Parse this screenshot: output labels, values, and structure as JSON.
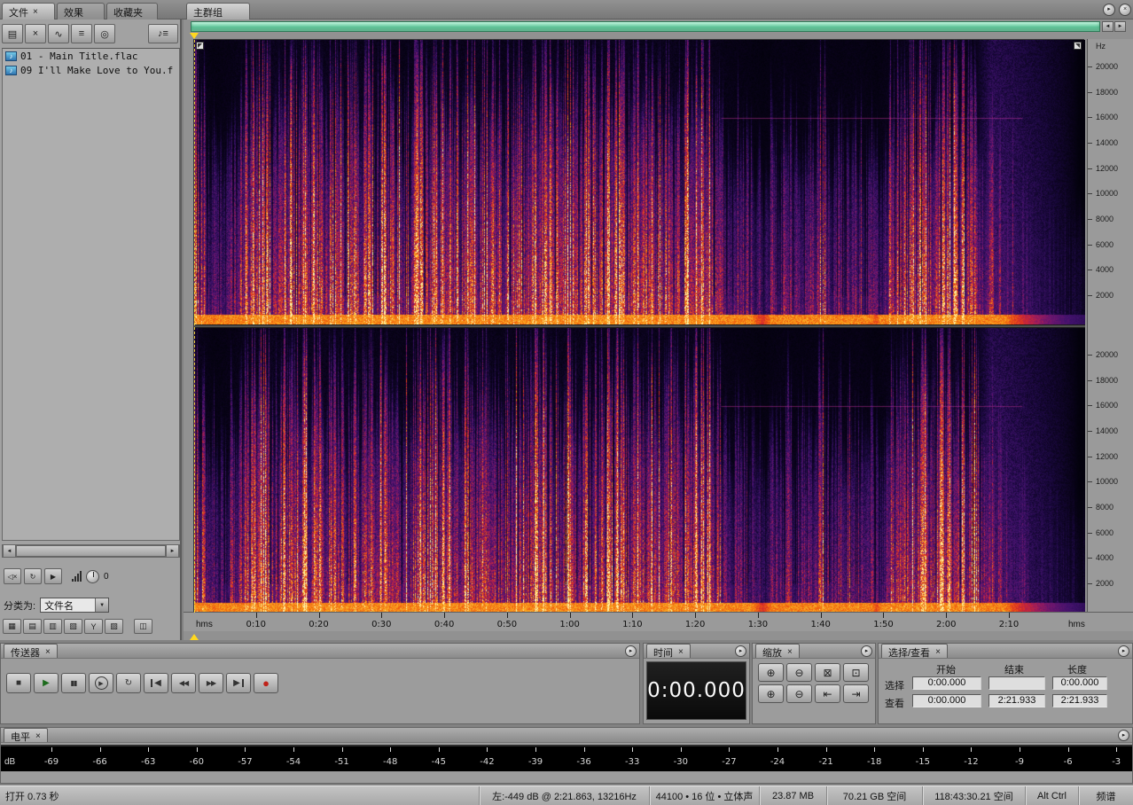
{
  "icons": {
    "close": "×",
    "panel_menu": "▸",
    "dropdown_arrow": "▼",
    "scroll_left": "◄",
    "scroll_right": "►",
    "music_note": "♪"
  },
  "app": {
    "left_tabs": [
      {
        "label": "文件"
      },
      {
        "label": "效果"
      },
      {
        "label": "收藏夹"
      }
    ],
    "main_tab": "主群组"
  },
  "files_panel": {
    "toolbar_buttons": [
      {
        "name": "import-file-button",
        "glyph": "▤"
      },
      {
        "name": "close-file-button",
        "glyph": "×"
      },
      {
        "name": "edit-view-button",
        "glyph": "∿"
      },
      {
        "name": "multitrack-view-button",
        "glyph": "≡"
      },
      {
        "name": "cd-view-button",
        "glyph": "◎"
      },
      {
        "name": "options-button",
        "glyph": "♪≡",
        "wide": true
      }
    ],
    "files": [
      {
        "name": "01 - Main Title.flac"
      },
      {
        "name": "09 I'll Make Love to You.f"
      }
    ],
    "preview_buttons": [
      {
        "name": "mute-preview-button",
        "glyph": "◁×"
      },
      {
        "name": "loop-preview-button",
        "glyph": "↻"
      },
      {
        "name": "preview-play-button",
        "glyph": "▶"
      }
    ],
    "preview_volume": "0",
    "sort_label": "分类为:",
    "sort_value": "文件名",
    "toggle_buttons": [
      {
        "name": "show-file-types-toggle",
        "glyph": "▦"
      },
      {
        "name": "show-full-path-toggle",
        "glyph": "▤"
      },
      {
        "name": "show-markers-toggle",
        "glyph": "▥"
      },
      {
        "name": "show-details-toggle",
        "glyph": "▧"
      },
      {
        "name": "filter-files-toggle",
        "glyph": "Y"
      },
      {
        "name": "auto-play-files-toggle",
        "glyph": "▨"
      },
      {
        "name": "link-options-button",
        "glyph": "◫"
      }
    ]
  },
  "timeline": {
    "left_unit": "hms",
    "right_unit": "hms",
    "ticks": [
      "0:10",
      "0:20",
      "0:30",
      "0:40",
      "0:50",
      "1:00",
      "1:10",
      "1:20",
      "1:30",
      "1:40",
      "1:50",
      "2:00",
      "2:10"
    ]
  },
  "freq_ruler": {
    "unit": "Hz",
    "labels": [
      "20000",
      "18000",
      "16000",
      "14000",
      "12000",
      "10000",
      "8000",
      "6000",
      "4000",
      "2000"
    ]
  },
  "transport": {
    "title": "传送器",
    "buttons": [
      {
        "name": "stop-button",
        "glyph": "■"
      },
      {
        "name": "play-button",
        "glyph": "▶",
        "color": "#1d6b1d"
      },
      {
        "name": "pause-button",
        "glyph": "▮▮",
        "small": true
      },
      {
        "name": "play-looped-button",
        "glyph": "▶",
        "circled": true
      },
      {
        "name": "loop-playback-button",
        "glyph": "↻"
      },
      {
        "name": "go-to-beginning-button",
        "glyph": "◀",
        "bar": "left"
      },
      {
        "name": "rewind-button",
        "glyph": "◀◀",
        "small": true
      },
      {
        "name": "fast-forward-button",
        "glyph": "▶▶",
        "small": true
      },
      {
        "name": "go-to-end-button",
        "glyph": "▶",
        "bar": "right"
      },
      {
        "name": "record-button",
        "glyph": "●",
        "color": "#c0231a",
        "big": true
      }
    ]
  },
  "time_panel": {
    "title": "时间",
    "value": "0:00.000"
  },
  "zoom_panel": {
    "title": "缩放",
    "buttons": [
      {
        "name": "zoom-in-horizontal-button",
        "glyph": "⊕"
      },
      {
        "name": "zoom-out-horizontal-button",
        "glyph": "⊖"
      },
      {
        "name": "zoom-out-full-button",
        "glyph": "⊠"
      },
      {
        "name": "zoom-to-selection-button",
        "glyph": "⊡"
      },
      {
        "name": "zoom-in-vertical-button",
        "glyph": "⊕"
      },
      {
        "name": "zoom-out-vertical-button",
        "glyph": "⊖"
      },
      {
        "name": "zoom-to-selection-left-button",
        "glyph": "⇤"
      },
      {
        "name": "zoom-to-selection-right-button",
        "glyph": "⇥"
      }
    ]
  },
  "selection_panel": {
    "title": "选择/查看",
    "columns": [
      "开始",
      "结束",
      "长度"
    ],
    "rows": [
      {
        "label": "选择",
        "start": "0:00.000",
        "end": "",
        "length": "0:00.000"
      },
      {
        "label": "查看",
        "start": "0:00.000",
        "end": "2:21.933",
        "length": "2:21.933"
      }
    ]
  },
  "levels_panel": {
    "title": "电平",
    "unit": "dB",
    "scale": [
      "-69",
      "-66",
      "-63",
      "-60",
      "-57",
      "-54",
      "-51",
      "-48",
      "-45",
      "-42",
      "-39",
      "-36",
      "-33",
      "-30",
      "-27",
      "-24",
      "-21",
      "-18",
      "-15",
      "-12",
      "-9",
      "-6",
      "-3"
    ]
  },
  "status_bar": {
    "items": [
      "打开 0.73 秒",
      "左:-449 dB @ 2:21.863, 13216Hz",
      "44100 • 16 位 • 立体声",
      "23.87 MB",
      "70.21 GB 空间",
      "118:43:30.21 空间",
      "Alt Ctrl",
      "频谱"
    ]
  },
  "spectrogram": {
    "channels": 2,
    "duration_s": 142,
    "freq_max_hz": 22050,
    "tail_start_s": 124,
    "tone_line": {
      "freq_hz": 16000,
      "from_s": 84,
      "to_s": 132
    },
    "envelope": [
      0.92,
      0.38,
      0.55,
      0.85,
      0.9,
      0.86,
      0.9,
      0.82,
      0.86,
      0.72,
      0.86,
      0.62,
      0.9,
      0.85,
      0.8,
      0.9,
      0.72,
      0.86,
      0.9,
      0.8,
      0.86,
      0.76,
      0.9,
      0.85,
      0.9,
      0.8,
      0.86,
      0.9,
      0.55,
      0.48,
      0.32,
      0.55,
      0.42,
      0.6,
      0.46,
      0.52,
      0.36,
      0.75,
      0.9,
      0.86,
      0.9,
      0.82,
      0.55,
      0.38,
      0.28,
      0.2,
      0.14,
      0.1
    ],
    "colormap": [
      [
        0,
        2,
        1,
        10
      ],
      [
        0.12,
        26,
        8,
        62
      ],
      [
        0.25,
        64,
        18,
        108
      ],
      [
        0.38,
        110,
        22,
        110
      ],
      [
        0.5,
        168,
        30,
        86
      ],
      [
        0.62,
        216,
        44,
        40
      ],
      [
        0.75,
        240,
        100,
        16
      ],
      [
        0.87,
        250,
        166,
        28
      ],
      [
        1,
        255,
        245,
        170
      ]
    ],
    "playhead_color": "#ffd820"
  }
}
